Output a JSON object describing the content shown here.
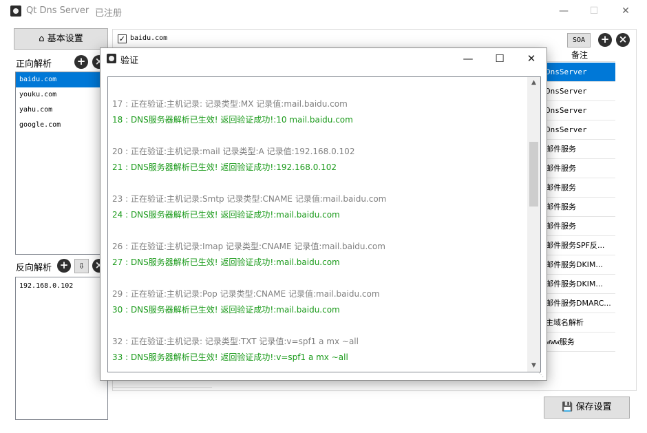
{
  "window": {
    "title": "Qt Dns Server",
    "registration": "已注册",
    "minimize": "—",
    "maximize": "☐",
    "close": "✕"
  },
  "sidebar": {
    "basic_settings": "基本设置",
    "forward_label": "正向解析",
    "forward_domains": [
      "baidu.com",
      "youku.com",
      "yahu.com",
      "google.com"
    ],
    "reverse_label": "反向解析",
    "reverse_ips": [
      "192.168.0.102"
    ]
  },
  "main": {
    "checkbox_checked": true,
    "domain": "baidu.com",
    "soa_button": "SOA",
    "column_header": "备注",
    "records": [
      "DnsServer",
      "DnsServer",
      "DnsServer",
      "DnsServer",
      "邮件服务",
      "邮件服务",
      "邮件服务",
      "邮件服务",
      "邮件服务",
      "邮件服务SPF反...",
      "邮件服务DKIM...",
      "邮件服务DKIM...",
      "邮件服务DMARC...",
      "主域名解析",
      "www服务"
    ],
    "save_button": "保存设置"
  },
  "dialog": {
    "title": "验证",
    "minimize": "—",
    "maximize": "☐",
    "close": "✕",
    "log": [
      {
        "kind": "info",
        "text": "17 : 正在验证:主机记录: 记录类型:MX 记录值:mail.baidu.com"
      },
      {
        "kind": "ok",
        "text": "18 : DNS服务器解析已生效!  返回验证成功!:10 mail.baidu.com"
      },
      {
        "kind": "info",
        "text": "20 : 正在验证:主机记录:mail 记录类型:A 记录值:192.168.0.102"
      },
      {
        "kind": "ok",
        "text": "21 : DNS服务器解析已生效!  返回验证成功!:192.168.0.102"
      },
      {
        "kind": "info",
        "text": "23 : 正在验证:主机记录:Smtp 记录类型:CNAME 记录值:mail.baidu.com"
      },
      {
        "kind": "ok",
        "text": "24 : DNS服务器解析已生效!  返回验证成功!:mail.baidu.com"
      },
      {
        "kind": "info",
        "text": "26 : 正在验证:主机记录:Imap 记录类型:CNAME 记录值:mail.baidu.com"
      },
      {
        "kind": "ok",
        "text": "27 : DNS服务器解析已生效!  返回验证成功!:mail.baidu.com"
      },
      {
        "kind": "info",
        "text": "29 : 正在验证:主机记录:Pop 记录类型:CNAME 记录值:mail.baidu.com"
      },
      {
        "kind": "ok",
        "text": "30 : DNS服务器解析已生效!  返回验证成功!:mail.baidu.com"
      },
      {
        "kind": "info",
        "text": "32 : 正在验证:主机记录: 记录类型:TXT 记录值:v=spf1 a mx ~all"
      },
      {
        "kind": "ok",
        "text": "33 : DNS服务器解析已生效!  返回验证成功!:v=spf1 a mx ~all"
      }
    ]
  },
  "colors": {
    "selection": "#0078d7",
    "log_info": "#808080",
    "log_success": "#1a9a1a"
  },
  "icons": [
    "app-logo-icon",
    "home-icon",
    "add-icon",
    "remove-icon",
    "import-icon",
    "save-icon",
    "checkbox-check-icon"
  ]
}
